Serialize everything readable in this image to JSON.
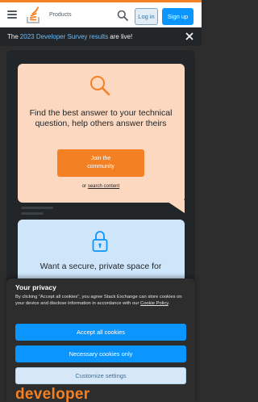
{
  "header": {
    "products_label": "Products",
    "login_label": "Log in",
    "signup_label": "Sign up"
  },
  "banner": {
    "prefix": "The",
    "link_text": "2023 Developer Survey results",
    "suffix": "are live!"
  },
  "hero": {
    "card_title": "Find the best answer to your technical question, help others answer theirs",
    "join_line1": "Join the",
    "join_line2": "community",
    "or_text": "or",
    "search_content_link": "search content",
    "secure_title": "Want a secure, private space for",
    "background_word": "developer"
  },
  "consent": {
    "title": "Your privacy",
    "body": "By clicking “Accept all cookies”, you agree Stack Exchange can store cookies on your device and disclose information in accordance with our",
    "policy_link": "Cookie Policy",
    "policy_suffix": ".",
    "accept_all": "Accept all cookies",
    "necessary_only": "Necessary cookies only",
    "customize": "Customize settings"
  },
  "colors": {
    "brand_orange": "#f48024",
    "primary_blue": "#0a95ff",
    "dark_bg": "#2d2d2d",
    "orange_card": "#fbd8bf",
    "blue_card": "#cfe6fa"
  },
  "icons": [
    "hamburger-icon",
    "stackoverflow-logo",
    "search-icon",
    "close-icon",
    "magnifier-icon",
    "lock-icon"
  ]
}
